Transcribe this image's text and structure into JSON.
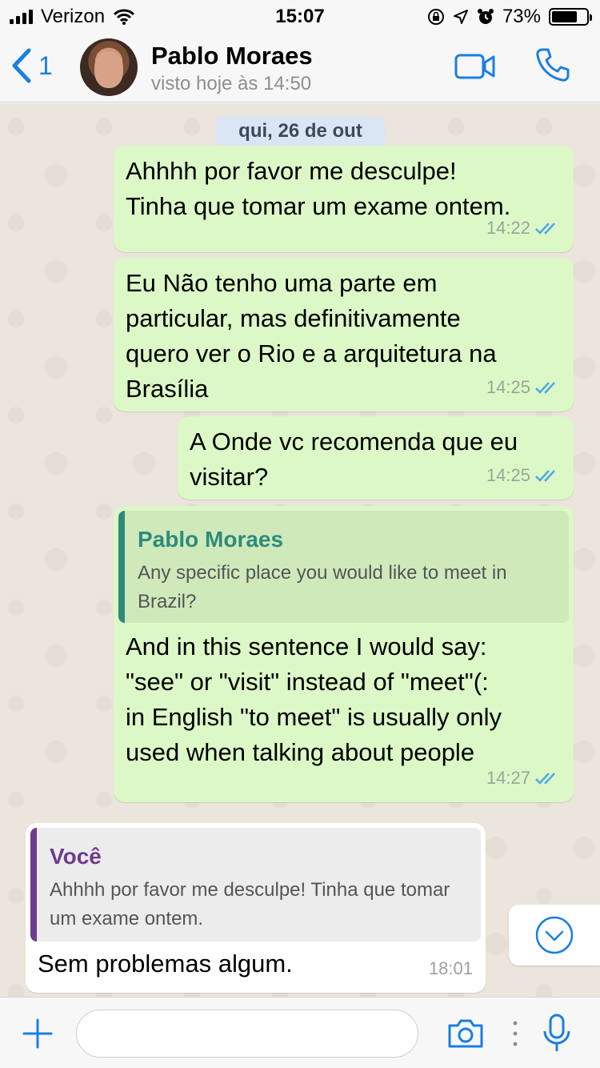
{
  "status_bar": {
    "carrier": "Verizon",
    "time": "15:07",
    "battery": "73%",
    "battery_level": 0.73,
    "icons": [
      "signal-icon",
      "wifi-icon",
      "orientation-lock-icon",
      "location-icon",
      "alarm-icon",
      "battery-icon"
    ]
  },
  "header": {
    "back_count": "1",
    "contact_name": "Pablo Moraes",
    "contact_status": "visto hoje às 14:50",
    "icons": [
      "back-chevron-icon",
      "video-call-icon",
      "phone-icon"
    ]
  },
  "chat": {
    "date": "qui, 26 de out",
    "messages": [
      {
        "direction": "out",
        "text": "Ahhhh por favor me desculpe!\nTinha que tomar um exame ontem.",
        "time": "14:22",
        "status": "read"
      },
      {
        "direction": "out",
        "text": "Eu Não tenho uma parte em\nparticular, mas definitivamente\nquero ver o Rio e a arquitetura na\nBrasília",
        "time": "14:25",
        "status": "read"
      },
      {
        "direction": "out",
        "text": "A Onde vc recomenda que eu\nvisitar?",
        "time": "14:25",
        "status": "read"
      },
      {
        "direction": "out",
        "quote": {
          "name": "Pablo Moraes",
          "text": "Any specific place you would like to meet in Brazil?"
        },
        "text": "And in this sentence I would say:\n\"see\" or \"visit\" instead of \"meet\"(:\nin English \"to meet\" is usually only\nused when talking about people",
        "time": "14:27",
        "status": "read"
      },
      {
        "direction": "in",
        "quote": {
          "name": "Você",
          "text": "Ahhhh por favor me desculpe! Tinha que tomar um exame ontem."
        },
        "text": "Sem problemas algum.",
        "time": "18:01"
      }
    ]
  },
  "input_bar": {
    "placeholder": "",
    "icons": [
      "plus-icon",
      "camera-icon",
      "more-icon",
      "microphone-icon"
    ]
  },
  "colors": {
    "accent": "#1a7fe0",
    "outgoing_bubble": "#dcf8c6",
    "incoming_bubble": "#ffffff",
    "read_ticks": "#4fa6e8",
    "quote_green": "#2e8b7c",
    "quote_purple": "#6e3b8f"
  }
}
